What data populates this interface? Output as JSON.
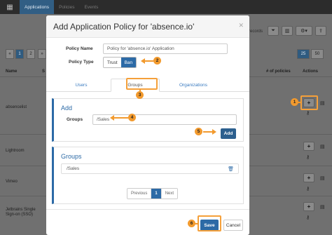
{
  "nav": {
    "tabs": [
      "Applications",
      "Policies",
      "Events"
    ],
    "active": "Applications"
  },
  "background": {
    "records_label": "records",
    "pager": [
      "«",
      "1",
      "2",
      "»"
    ],
    "page_sizes": [
      "25",
      "50"
    ],
    "headers": [
      "Name",
      "S",
      "# of policies",
      "Actions"
    ],
    "rows": [
      {
        "name": "absencelist"
      },
      {
        "name": "Lightroom"
      },
      {
        "name": "Vimeo"
      },
      {
        "name": "Jetbrains Single Sign-on (SSO)"
      }
    ],
    "add_label": "+",
    "key_icon_label": "key-icon"
  },
  "modal": {
    "title": "Add Application Policy for 'absence.io'",
    "close": "✕",
    "policy_name_label": "Policy Name",
    "policy_name_value": "Policy for 'absence.io' Application",
    "policy_type_label": "Policy Type",
    "policy_type_options": [
      "Trust",
      "Ban"
    ],
    "policy_type_selected": "Ban",
    "tabs": [
      "Users",
      "Groups",
      "Organizations"
    ],
    "active_tab": "Groups",
    "add_section": {
      "title": "Add",
      "groups_label": "Groups",
      "groups_value": "/Sales",
      "add_button": "Add"
    },
    "groups_section": {
      "title": "Groups",
      "items": [
        "/Sales"
      ]
    },
    "pagination": {
      "previous": "Previous",
      "current": "1",
      "next": "Next"
    },
    "footer": {
      "save": "Save",
      "cancel": "Cancel"
    }
  },
  "callouts": [
    "1",
    "2",
    "3",
    "4",
    "5",
    "6"
  ],
  "colors": {
    "accent": "#2c6aa6",
    "callout": "#f29a2e",
    "navbar": "#2c2c2c"
  }
}
